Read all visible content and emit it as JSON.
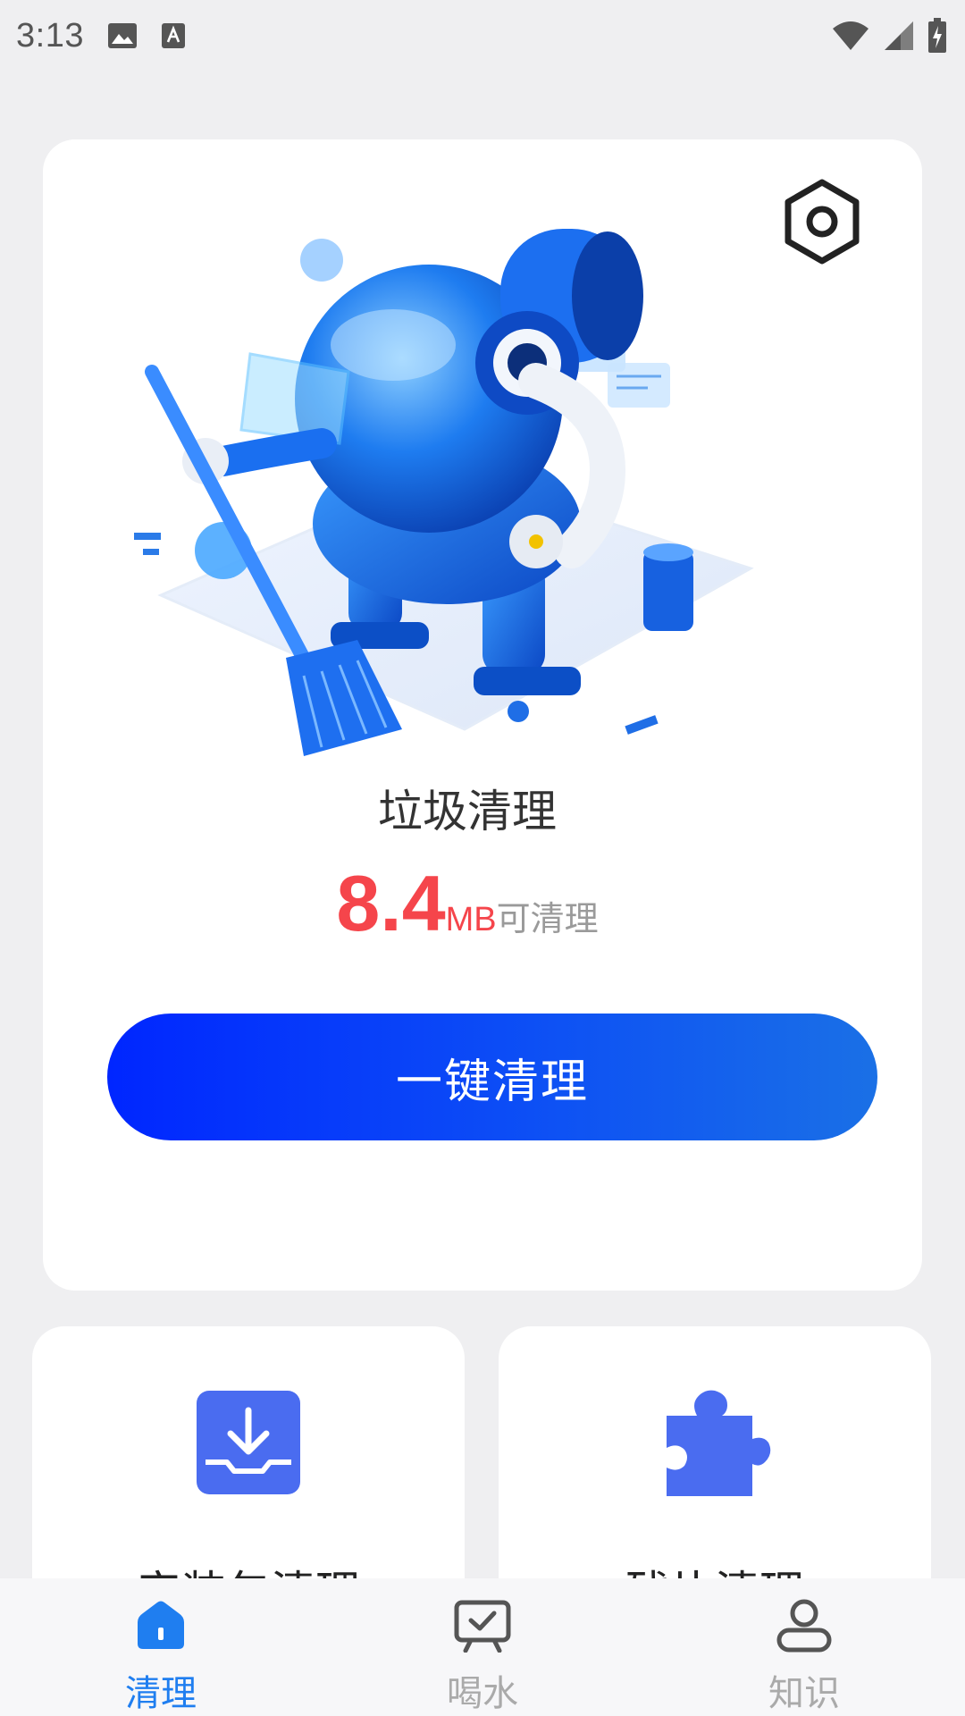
{
  "status_bar": {
    "time": "3:13",
    "icons": [
      "image-icon",
      "text-a-icon",
      "wifi-icon",
      "signal-icon",
      "battery-icon"
    ]
  },
  "main_card": {
    "hero_image": "robot-sweeping-illustration",
    "settings_icon": "hexagon-settings-icon",
    "title": "垃圾清理",
    "size_value": "8.4",
    "size_unit": "MB",
    "size_suffix": "可清理",
    "clean_button_label": "一键清理"
  },
  "feature_cards": [
    {
      "label": "安装包清理",
      "icon": "download-tray-icon"
    },
    {
      "label": "残片清理",
      "icon": "puzzle-piece-icon"
    }
  ],
  "bottom_nav": {
    "items": [
      {
        "label": "清理",
        "icon": "home-icon",
        "active": true
      },
      {
        "label": "喝水",
        "icon": "board-check-icon",
        "active": false
      },
      {
        "label": "知识",
        "icon": "person-icon",
        "active": false
      }
    ]
  },
  "colors": {
    "accent": "#1f7ef0",
    "danger": "#f5454b",
    "button_start": "#0026ff",
    "button_end": "#1a70e6",
    "feature_icon": "#4a6cf0",
    "background": "#efeff1"
  }
}
